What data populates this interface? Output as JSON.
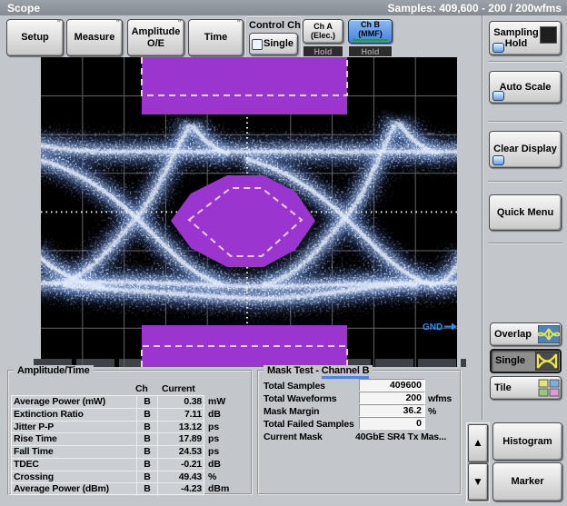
{
  "titlebar": {
    "title": "Scope",
    "samples": "Samples: 409,600 - 200 / 200wfms"
  },
  "toolbar": {
    "setup": "Setup",
    "measure": "Measure",
    "amplitude_oe": "Amplitude O/E",
    "time": "Time",
    "control_ch_label": "Control Ch",
    "single_label": "Single",
    "ch_a": "Ch A",
    "ch_a_sub": "(Elec.)",
    "ch_b": "Ch B",
    "ch_b_sub": "(MMF)",
    "hold_a": "Hold",
    "hold_b": "Hold"
  },
  "right_panel": {
    "sampling_hold": "Sampling Hold",
    "auto_scale": "Auto Scale",
    "clear_display": "Clear Display",
    "quick_menu": "Quick Menu",
    "overlap": "Overlap",
    "single": "Single",
    "tile": "Tile",
    "histogram": "Histogram",
    "marker": "Marker",
    "up_arrow": "▲",
    "down_arrow": "▼"
  },
  "display": {
    "gnd_label": "GND",
    "colors": {
      "mask_purple": "#9a35cf",
      "mask_dash": "#eec9f0",
      "trace_core": "#eef3ff",
      "trace_halo": "#46639f",
      "grid": "#646464",
      "gnd_blue": "#1e90ff",
      "background": "#000000"
    }
  },
  "amplitude_panel": {
    "title": "Amplitude/Time",
    "col_ch": "Ch",
    "col_current": "Current",
    "rows": [
      {
        "label": "Average Power (mW)",
        "ch": "B",
        "value": "0.38",
        "unit": "mW"
      },
      {
        "label": "Extinction Ratio",
        "ch": "B",
        "value": "7.11",
        "unit": "dB"
      },
      {
        "label": "Jitter P-P",
        "ch": "B",
        "value": "13.12",
        "unit": "ps"
      },
      {
        "label": "Rise Time",
        "ch": "B",
        "value": "17.89",
        "unit": "ps"
      },
      {
        "label": "Fall Time",
        "ch": "B",
        "value": "24.53",
        "unit": "ps"
      },
      {
        "label": "TDEC",
        "ch": "B",
        "value": "-0.21",
        "unit": "dB"
      },
      {
        "label": "Crossing",
        "ch": "B",
        "value": "49.43",
        "unit": "%"
      },
      {
        "label": "Average Power (dBm)",
        "ch": "B",
        "value": "-4.23",
        "unit": "dBm"
      }
    ]
  },
  "mask_panel": {
    "title_prefix": "Mask Test -",
    "channel": "Channel B",
    "rows": [
      {
        "label": "Total Samples",
        "value": "409600",
        "unit": ""
      },
      {
        "label": "Total Waveforms",
        "value": "200",
        "unit": "wfms"
      },
      {
        "label": "Mask Margin",
        "value": "36.2",
        "unit": "%"
      },
      {
        "label": "Total Failed Samples",
        "value": "0",
        "unit": ""
      }
    ],
    "current_mask_label": "Current Mask",
    "current_mask_value": "40GbE SR4 Tx Mas..."
  }
}
